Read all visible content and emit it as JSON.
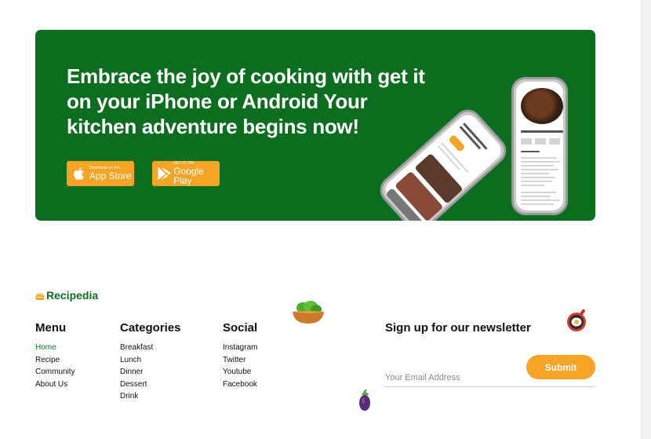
{
  "banner": {
    "title": "Embrace the joy of cooking with get it on your iPhone or Android Your kitchen adventure begins now!",
    "app_store": {
      "small": "Download on the",
      "big": "App Store"
    },
    "google_play": {
      "small": "GET IT ON",
      "big": "Google Play"
    },
    "background_color": "#0b6e1f",
    "button_color": "#f5a425"
  },
  "footer": {
    "brand": "Recipedia",
    "menu": {
      "heading": "Menu",
      "items": [
        "Home",
        "Recipe",
        "Community",
        "About Us"
      ]
    },
    "categories": {
      "heading": "Categories",
      "items": [
        "Breakfast",
        "Lunch",
        "Dinner",
        "Dessert",
        "Drink"
      ]
    },
    "social": {
      "heading": "Social",
      "items": [
        "Instagram",
        "Twitter",
        "Youtube",
        "Facebook"
      ]
    },
    "newsletter": {
      "title": "Sign up for our newsletter",
      "email_placeholder": "Your Email Address",
      "submit_label": "Submit"
    }
  },
  "icons": [
    "apple-icon",
    "google-play-icon",
    "salad-bowl-icon",
    "fried-egg-pan-icon",
    "eggplant-icon",
    "recipedia-logo-icon"
  ]
}
